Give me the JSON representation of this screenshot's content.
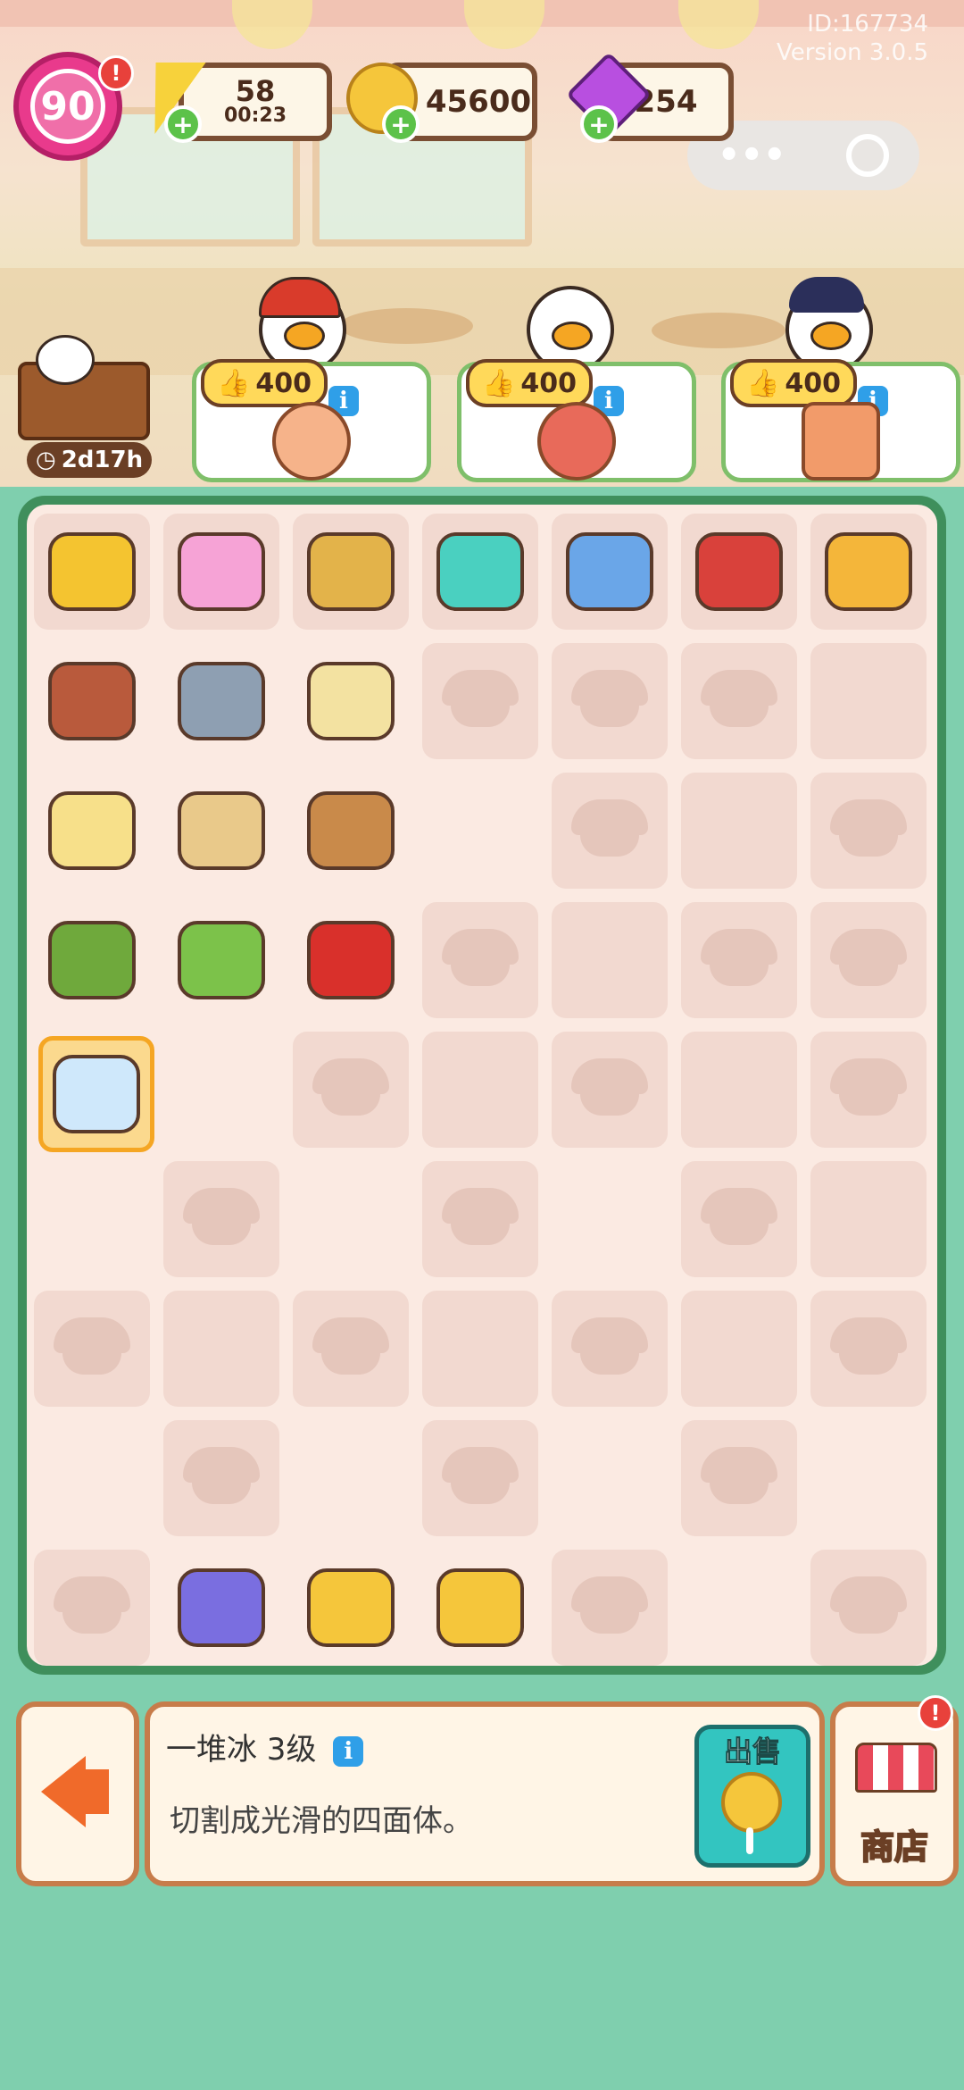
{
  "top_bar": {
    "level": "90",
    "energy": {
      "value": "58",
      "timer": "00:23"
    },
    "coins": "45600",
    "gems": "254",
    "id_text": "ID:167734",
    "version_text": "Version 3.0.5"
  },
  "event": {
    "timer": "2d17h"
  },
  "orders": [
    {
      "reward": "400"
    },
    {
      "reward": "400"
    },
    {
      "reward": "400"
    }
  ],
  "selected_item": {
    "name": "一堆冰 3级",
    "description": "切割成光滑的四面体。",
    "sell_label": "出售"
  },
  "shop": {
    "label": "商店"
  },
  "icons": [
    "level-badge-icon",
    "energy-icon",
    "coin-icon",
    "gem-icon",
    "thumbs-up-icon",
    "info-icon",
    "exit-icon",
    "shop-icon",
    "clock-icon",
    "bowl-placeholder-icon"
  ],
  "colors": {
    "board_border": "#3f8f5c",
    "background": "#7fcfae",
    "accent": "#f5a623"
  }
}
